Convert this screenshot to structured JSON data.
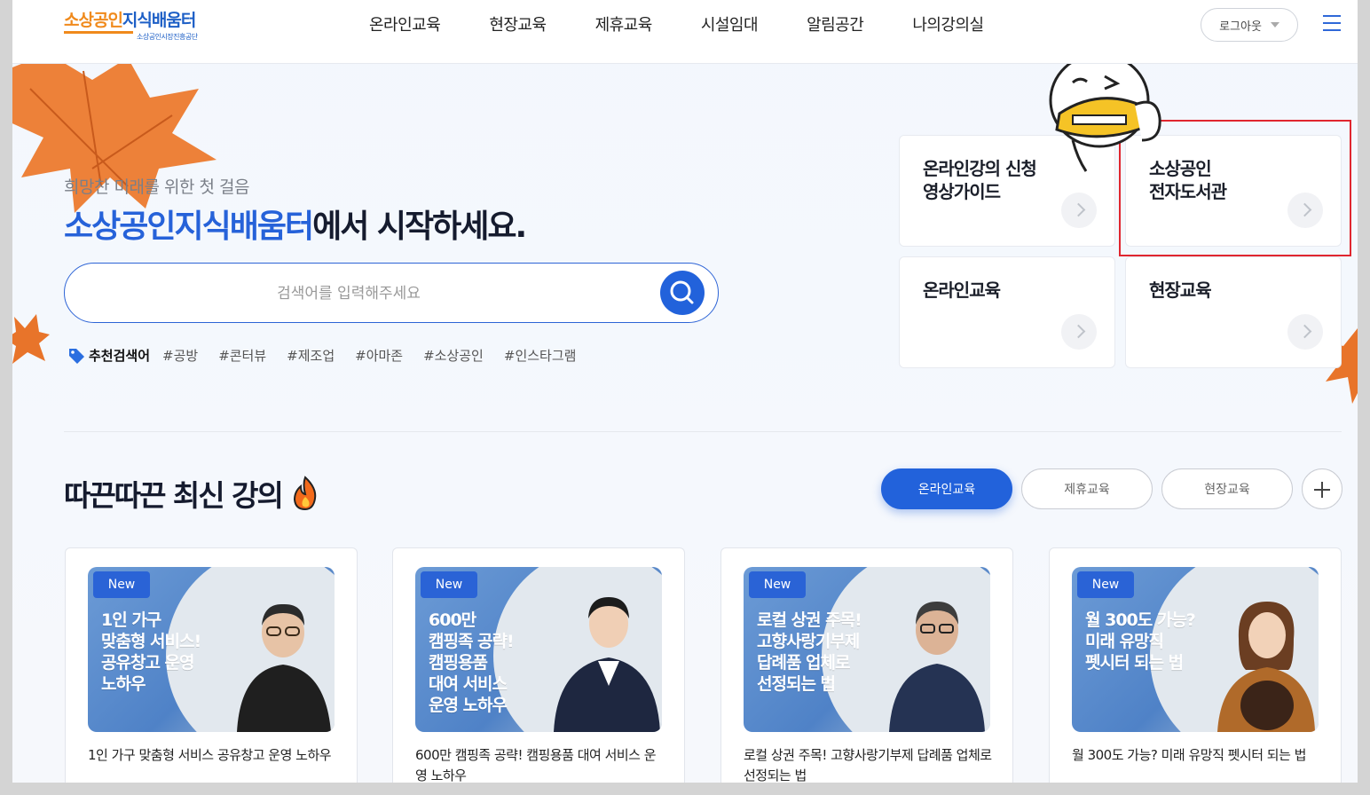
{
  "header": {
    "logo_text_a": "소상공인",
    "logo_text_b": "지식배움터",
    "logo_sub": "소상공인시장진흥공단",
    "nav": [
      "온라인교육",
      "현장교육",
      "제휴교육",
      "시설임대",
      "알림공간",
      "나의강의실"
    ],
    "logout_label": "로그아웃"
  },
  "hero": {
    "tagline": "희망찬 미래를 위한 첫 걸음",
    "headline_highlight": "소상공인지식배움터",
    "headline_rest": "에서 시작하세요.",
    "search_placeholder": "검색어를 입력해주세요",
    "tags_title": "추천검색어",
    "tags": [
      "#공방",
      "#콘터뷰",
      "#제조업",
      "#아마존",
      "#소상공인",
      "#인스타그램"
    ]
  },
  "quick_cards": [
    "온라인강의 신청\n영상가이드",
    "소상공인\n전자도서관",
    "온라인교육",
    "현장교육"
  ],
  "latest": {
    "title": "따끈따끈 최신 강의",
    "filters": [
      "온라인교육",
      "제휴교육",
      "현장교육"
    ],
    "active_filter": "온라인교육",
    "courses": [
      {
        "badge": "New",
        "thumb_title": "1인 가구\n맞춤형 서비스!\n공유창고 운영\n노하우",
        "name": "1인 가구 맞춤형 서비스 공유창고 운영 노하우"
      },
      {
        "badge": "New",
        "thumb_title": "600만\n캠핑족 공략!\n캠핑용품\n대여 서비스\n운영 노하우",
        "name": "600만 캠핑족 공략! 캠핑용품 대여 서비스 운영 노하우"
      },
      {
        "badge": "New",
        "thumb_title": "로컬 상권 주목!\n고향사랑기부제\n답례품 업체로\n선정되는 법",
        "name": "로컬 상권 주목! 고향사랑기부제 답례품 업체로 선정되는 법"
      },
      {
        "badge": "New",
        "thumb_title": "월 300도 가능?\n미래 유망직\n펫시터 되는 법",
        "name": "월 300도 가능? 미래 유망직 펫시터 되는 법"
      }
    ]
  },
  "colors": {
    "primary": "#2262db",
    "accent_orange": "#f08a1c",
    "highlight_box": "#e0262f"
  }
}
